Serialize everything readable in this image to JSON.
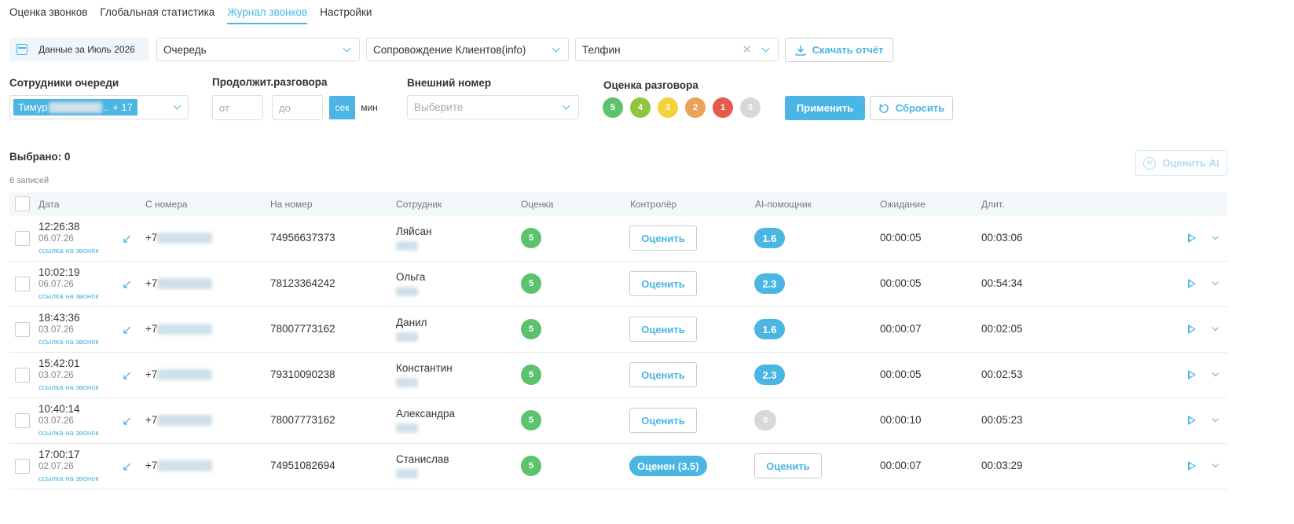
{
  "tabs": [
    {
      "label": "Оценка звонков"
    },
    {
      "label": "Глобальная статистика"
    },
    {
      "label": "Журнал звонков",
      "active": true
    },
    {
      "label": "Настройки"
    }
  ],
  "filters": {
    "date_label": "Данные за Июль 2026",
    "queue_select": "Очередь",
    "service_select": "Сопровождение Клиентов(info)",
    "provider_select": "Телфин",
    "download_label": "Скачать отчёт"
  },
  "labels": {
    "employees": "Сотрудники очереди",
    "duration": "Продолжит.разговора",
    "external": "Внешний номер",
    "rating": "Оценка разговора"
  },
  "employees_chip": {
    "name": "Тимур",
    "more": ".. + 17"
  },
  "duration": {
    "from_placeholder": "от",
    "to_placeholder": "до",
    "unit_sec": "сек",
    "unit_min": "мин"
  },
  "external": {
    "placeholder": "Выберите"
  },
  "rating_options": [
    {
      "value": "5",
      "color": "#5cc36c"
    },
    {
      "value": "4",
      "color": "#8dc63f"
    },
    {
      "value": "3",
      "color": "#f5d23c"
    },
    {
      "value": "2",
      "color": "#e8a25a"
    },
    {
      "value": "1",
      "color": "#e25b4c"
    },
    {
      "value": "0",
      "color": "#d8d8d8"
    }
  ],
  "actions": {
    "apply": "Применить",
    "reset": "Сбросить",
    "ai_rate": "Оценить AI"
  },
  "selected": "Выбрано: 0",
  "records": "6 записей",
  "columns": [
    "Дата",
    "С номера",
    "На номер",
    "Сотрудник",
    "Оценка",
    "Контролёр",
    "AI-помощник",
    "Ожидание",
    "Длит."
  ],
  "link_text": "ссылка на звонок",
  "rate_button": "Оценить",
  "rows": [
    {
      "time": "12:26:38",
      "date": "06.07.26",
      "from": "+7",
      "to": "74956637373",
      "employee": "Ляйсан",
      "grade": "5",
      "controller": "Оценить",
      "ai": "1.6",
      "wait": "00:00:05",
      "dur": "00:03:06"
    },
    {
      "time": "10:02:19",
      "date": "06.07.26",
      "from": "+7",
      "to": "78123364242",
      "employee": "Ольга",
      "grade": "5",
      "controller": "Оценить",
      "ai": "2.3",
      "wait": "00:00:05",
      "dur": "00:54:34"
    },
    {
      "time": "18:43:36",
      "date": "03.07.26",
      "from": "+7",
      "to": "78007773162",
      "employee": "Данил",
      "grade": "5",
      "controller": "Оценить",
      "ai": "1.6",
      "wait": "00:00:07",
      "dur": "00:02:05"
    },
    {
      "time": "15:42:01",
      "date": "03.07.26",
      "from": "+7",
      "to": "79310090238",
      "employee": "Константин",
      "grade": "5",
      "controller": "Оценить",
      "ai": "2.3",
      "wait": "00:00:05",
      "dur": "00:02:53"
    },
    {
      "time": "10:40:14",
      "date": "03.07.26",
      "from": "+7",
      "to": "78007773162",
      "employee": "Александра",
      "grade": "5",
      "controller": "Оценить",
      "ai": "0",
      "wait": "00:00:10",
      "dur": "00:05:23"
    },
    {
      "time": "17:00:17",
      "date": "02.07.26",
      "from": "+7",
      "to": "74951082694",
      "employee": "Станислав",
      "grade": "5",
      "controller_rated": "Оценен (3.5)",
      "ai_button": "Оценить",
      "wait": "00:00:07",
      "dur": "00:03:29"
    }
  ]
}
